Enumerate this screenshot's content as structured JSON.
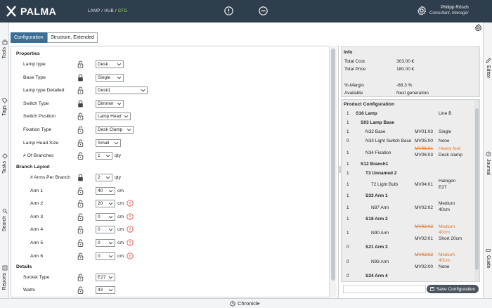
{
  "app": {
    "logo": "PALMA"
  },
  "breadcrumb": {
    "lamp": "LAMP",
    "hub": "HUB",
    "cfg": "CFG",
    "sep": "/"
  },
  "user": {
    "name": "Philipp Rösch",
    "role": "Consultant, Manager"
  },
  "tabs": {
    "configuration": "Configuration",
    "structure": "Structure, Extended"
  },
  "left_nav": [
    "Tools",
    "Tags",
    "Tasks",
    "Search",
    "Reports"
  ],
  "right_nav": [
    "Editor",
    "Journal",
    "Guide"
  ],
  "bottom": {
    "chronicle": "Chronicle"
  },
  "config": {
    "properties_title": "Properties",
    "branch_layout_title": "Branch Layout",
    "details_title": "Details",
    "properties": [
      {
        "label": "Lamp type",
        "value": "Desk",
        "lock": "open"
      },
      {
        "label": "Base Type",
        "value": "Single",
        "lock": "closed"
      },
      {
        "label": "Lamp type Detailed",
        "value": "Desk1",
        "lock": "open"
      },
      {
        "label": "Switch Type",
        "value": "Dimmer",
        "lock": "closed"
      },
      {
        "label": "Switch Position",
        "value": "Lamp Head",
        "lock": "open"
      },
      {
        "label": "Fixation Type",
        "value": "Desk Clamp",
        "lock": "open"
      },
      {
        "label": "Lamp Head Size",
        "value": "Small",
        "lock": "open"
      },
      {
        "label": "# Of Branches",
        "value": "1",
        "unit": "qty",
        "lock": "open"
      }
    ],
    "branch": [
      {
        "label": "# Arms Per Branch",
        "value": "2",
        "unit": "qty",
        "lock": "closed"
      },
      {
        "label": "Arm 1",
        "value": "40",
        "unit": "cm",
        "lock": "open",
        "warn": false
      },
      {
        "label": "Arm 2",
        "value": "20",
        "unit": "cm",
        "lock": "open",
        "warn": true
      },
      {
        "label": "Arm 3",
        "value": "0",
        "unit": "cm",
        "lock": "open",
        "warn": true
      },
      {
        "label": "Arm 4",
        "value": "0",
        "unit": "cm",
        "lock": "open",
        "warn": true
      },
      {
        "label": "Arm 5",
        "value": "0",
        "unit": "cm",
        "lock": "open",
        "warn": true
      },
      {
        "label": "Arm 6",
        "value": "0",
        "unit": "cm",
        "lock": "open",
        "warn": true
      }
    ],
    "details": [
      {
        "label": "Socket Type",
        "value": "E27",
        "lock": "open"
      },
      {
        "label": "Watts",
        "value": "43",
        "lock": "open"
      }
    ]
  },
  "info": {
    "title": "Info",
    "rows": [
      {
        "label": "Total Cost",
        "value": "303.00 €"
      },
      {
        "label": "Total Price",
        "value": "180.00 €"
      },
      {
        "label": "%-Margin",
        "value": "-68.3 %"
      },
      {
        "label": "Available",
        "value": "Next generation"
      }
    ]
  },
  "product": {
    "title": "Product Configuration",
    "rows": [
      {
        "qty": "1",
        "name": "S16  Lamp",
        "bold": true,
        "indent": 0,
        "code": "",
        "desc": "Line B"
      },
      {
        "qty": "1",
        "name": "S03  Lamp Base",
        "bold": true,
        "indent": 1,
        "code": "",
        "desc": ""
      },
      {
        "qty": "1",
        "name": "N32  Base",
        "bold": false,
        "indent": 2,
        "code": "MV01:03",
        "desc": "Single"
      },
      {
        "qty": "0",
        "name": "N33  Light Switch Base",
        "bold": false,
        "indent": 2,
        "code": "MV05:00",
        "desc": "None"
      },
      {
        "qty": "1",
        "name": "N34  Fixation",
        "bold": false,
        "indent": 2,
        "code_old": "MV06:01",
        "desc_old": "Heavy foot",
        "code": "MV06:03",
        "desc": "Desk clamp"
      },
      {
        "qty": "1",
        "name": "S12  Branch1",
        "bold": true,
        "indent": 1,
        "code": "",
        "desc": ""
      },
      {
        "qty": "1",
        "name": "T3  Unnamed 2",
        "bold": true,
        "indent": 2,
        "code": "",
        "desc": ""
      },
      {
        "qty": "1",
        "name": "72  Light Bulb",
        "bold": false,
        "indent": 3,
        "code": "MV04:01",
        "desc": "Halogen",
        "desc2": "E27"
      },
      {
        "qty": "1",
        "name": "S33  Arm 1",
        "bold": true,
        "indent": 2,
        "code": "",
        "desc": ""
      },
      {
        "qty": "1",
        "name": "N87  Arm",
        "bold": false,
        "indent": 3,
        "code": "MV02:02",
        "desc": "Medium",
        "desc2": "40cm"
      },
      {
        "qty": "1",
        "name": "S18  Arm 2",
        "bold": true,
        "indent": 2,
        "code": "",
        "desc": ""
      },
      {
        "qty": "1",
        "name": "N90  Arm",
        "bold": false,
        "indent": 3,
        "code_old": "MV02:02",
        "desc_old": "Medium",
        "desc_old2": "40cm",
        "code": "MV02:01",
        "desc": "Short 20cm"
      },
      {
        "qty": "0",
        "name": "S21  Arm 3",
        "bold": true,
        "indent": 2,
        "code": "",
        "desc": ""
      },
      {
        "qty": "0",
        "name": "N93  Arm",
        "bold": false,
        "indent": 3,
        "code_old": "MV02:02",
        "desc_old": "Medium",
        "desc_old2": "40cm",
        "code": "MV02:00",
        "desc": "None"
      },
      {
        "qty": "0",
        "name": "S24  Arm 4",
        "bold": true,
        "indent": 2,
        "code": "",
        "desc": ""
      },
      {
        "qty": "",
        "name": "",
        "bold": false,
        "indent": 3,
        "code": "",
        "desc_old": "Medium"
      }
    ],
    "save_label": "Save Configuration"
  },
  "colors": {
    "topbar": "#2f3e4c",
    "active_tab": "#3a6e95",
    "accent_green": "#9be15d",
    "changed": "#e0782b"
  }
}
